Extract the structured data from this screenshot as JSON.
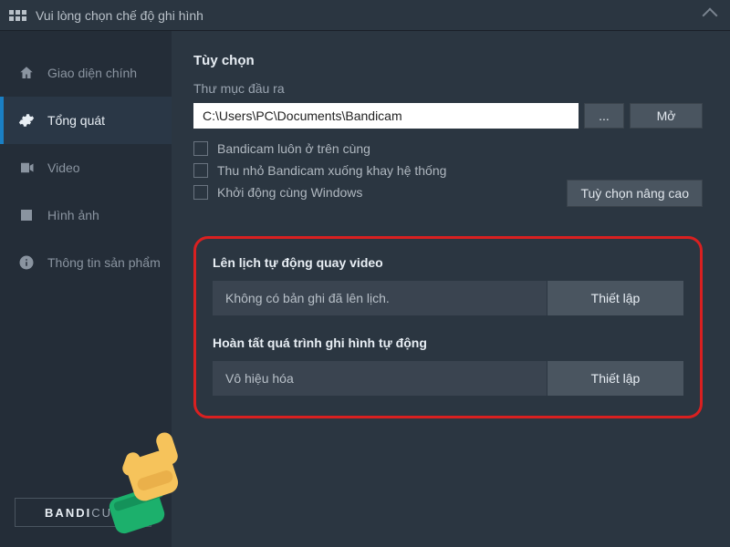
{
  "titlebar": {
    "text": "Vui lòng chọn chế độ ghi hình"
  },
  "sidebar": {
    "items": [
      {
        "label": "Giao diện chính"
      },
      {
        "label": "Tổng quát"
      },
      {
        "label": "Video"
      },
      {
        "label": "Hình ảnh"
      },
      {
        "label": "Thông tin sản phẩm"
      }
    ]
  },
  "options": {
    "title": "Tùy chọn",
    "output_label": "Thư mục đầu ra",
    "output_path": "C:\\Users\\PC\\Documents\\Bandicam",
    "browse_label": "...",
    "open_label": "Mở",
    "checkboxes": [
      "Bandicam luôn ở trên cùng",
      "Thu nhỏ Bandicam xuống khay hệ thống",
      "Khởi động cùng Windows"
    ],
    "advanced_label": "Tuỳ chọn nâng cao"
  },
  "schedule": {
    "title": "Lên lịch tự động quay video",
    "status": "Không có bản ghi đã lên lịch.",
    "setup_label": "Thiết lập"
  },
  "autocomplete": {
    "title": "Hoàn tất quá trình ghi hình tự động",
    "status": "Vô hiệu hóa",
    "setup_label": "Thiết lập"
  },
  "brand": {
    "prefix": "BANDI",
    "suffix": "CUT"
  }
}
